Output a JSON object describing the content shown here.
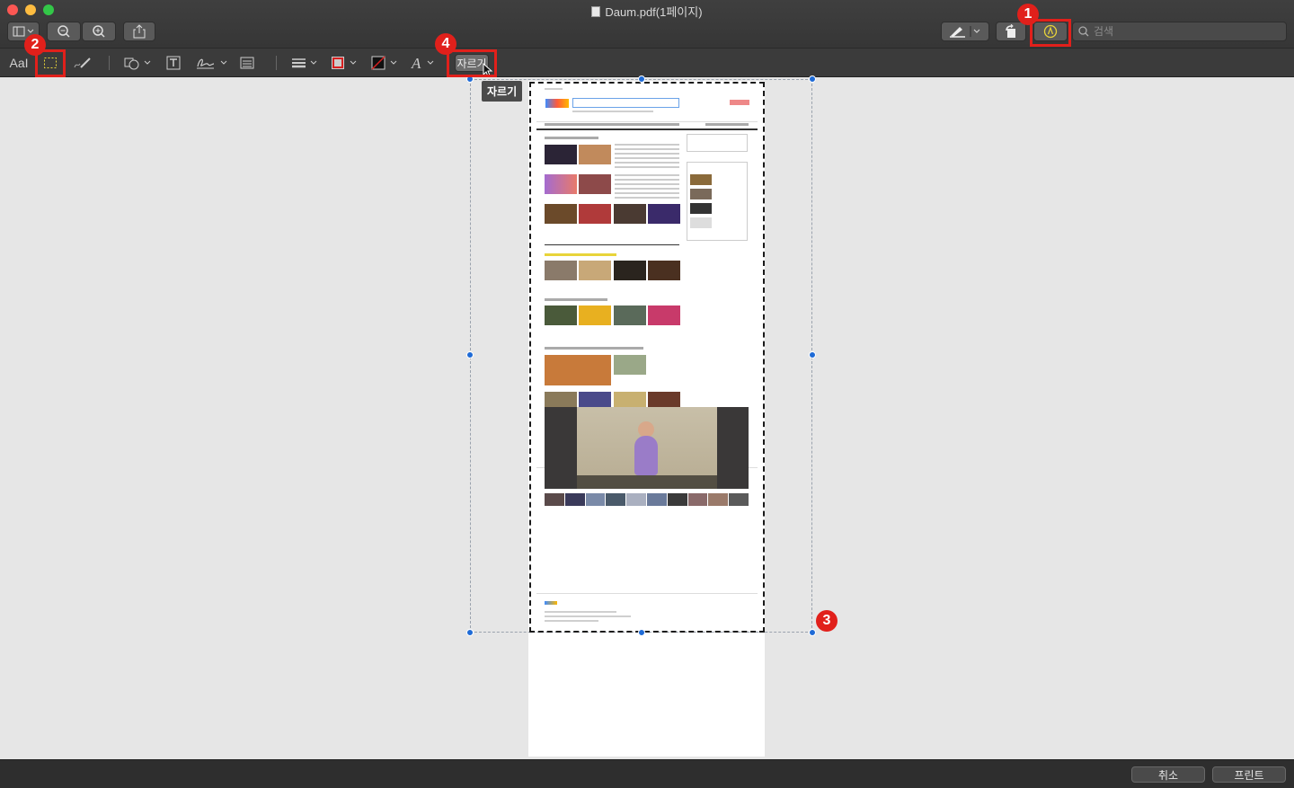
{
  "window": {
    "title": "Daum.pdf(1페이지)"
  },
  "toolbar": {
    "search_placeholder": "검색",
    "buttons": [
      "sidebar",
      "zoom-out",
      "zoom-in",
      "share",
      "highlight",
      "rotate",
      "markup"
    ]
  },
  "markup": {
    "text_style_label": "AaI",
    "crop_label": "자르기",
    "tooltip": "자르기"
  },
  "callouts": [
    "1",
    "2",
    "3",
    "4"
  ],
  "bottom": {
    "cancel_label": "취소",
    "print_label": "프린트"
  },
  "colors": {
    "callout": "#e1201b",
    "handle": "#1f6bd6",
    "accent_yellow": "#e8d43a"
  }
}
